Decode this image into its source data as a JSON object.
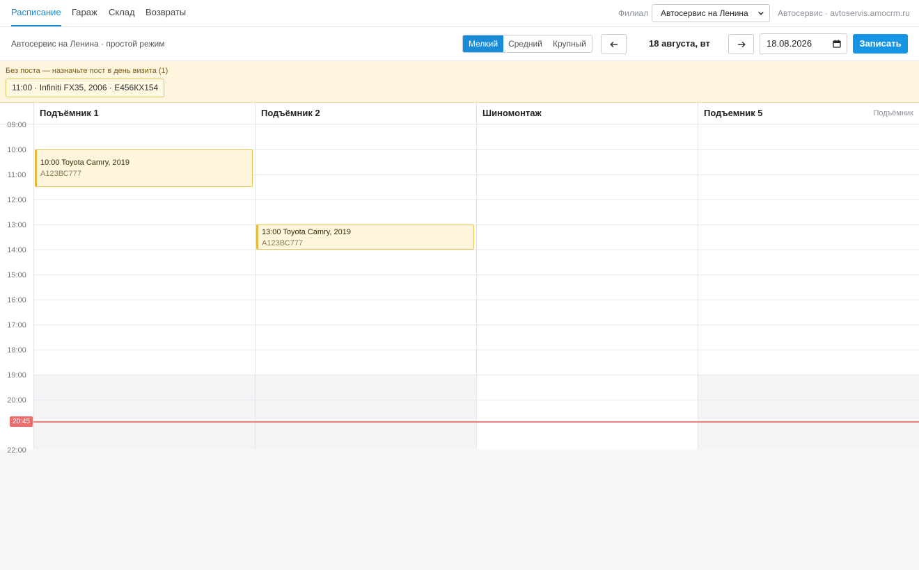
{
  "nav": {
    "tabs": [
      {
        "label": "Расписание",
        "active": true
      },
      {
        "label": "Гараж"
      },
      {
        "label": "Склад"
      },
      {
        "label": "Возвраты"
      }
    ],
    "branch_label": "Филиал",
    "branch_value": "Автосервис на Ленина",
    "company": "Автосервис · avtoservis.amocrm.ru"
  },
  "toolbar": {
    "subtitle": "Автосервис на Ленина · простой режим",
    "size_options": [
      "Мелкий",
      "Средний",
      "Крупный"
    ],
    "selected_size": "Мелкий",
    "prev_icon": "arrow-left-icon",
    "next_icon": "arrow-right-icon",
    "date_label": "18 августа, вт",
    "date_value": "18.08.2026",
    "book_button": "Записать"
  },
  "unassigned": {
    "title": "Без поста — назначьте пост в день визита (1)",
    "items": [
      "11:00 · Infiniti FX35, 2006 · Е456КХ154"
    ]
  },
  "schedule": {
    "columns": [
      {
        "name": "Подъёмник 1",
        "type": ""
      },
      {
        "name": "Подъёмник 2",
        "type": ""
      },
      {
        "name": "Шиномонтаж",
        "type": ""
      },
      {
        "name": "Подъемник 5",
        "type": "Подъёмник"
      }
    ],
    "hours": [
      "09:00",
      "10:00",
      "11:00",
      "12:00",
      "13:00",
      "14:00",
      "15:00",
      "16:00",
      "17:00",
      "18:00",
      "19:00",
      "20:00",
      "22:00"
    ],
    "now": "20:45",
    "events": [
      {
        "column": "Подъёмник 1",
        "title": "10:00 Toyota Camry, 2019",
        "plate": "А123ВС777"
      },
      {
        "column": "Подъёмник 2",
        "title": "13:00 Toyota Camry, 2019",
        "plate": "А123ВС777"
      }
    ]
  },
  "colors": {
    "accent": "#1a8bd6",
    "primary_button": "#1694e6",
    "banner_bg": "#fdf5dd",
    "event_bg": "#fdf6dc",
    "event_border": "#e6c451",
    "now_line": "#f08080"
  }
}
